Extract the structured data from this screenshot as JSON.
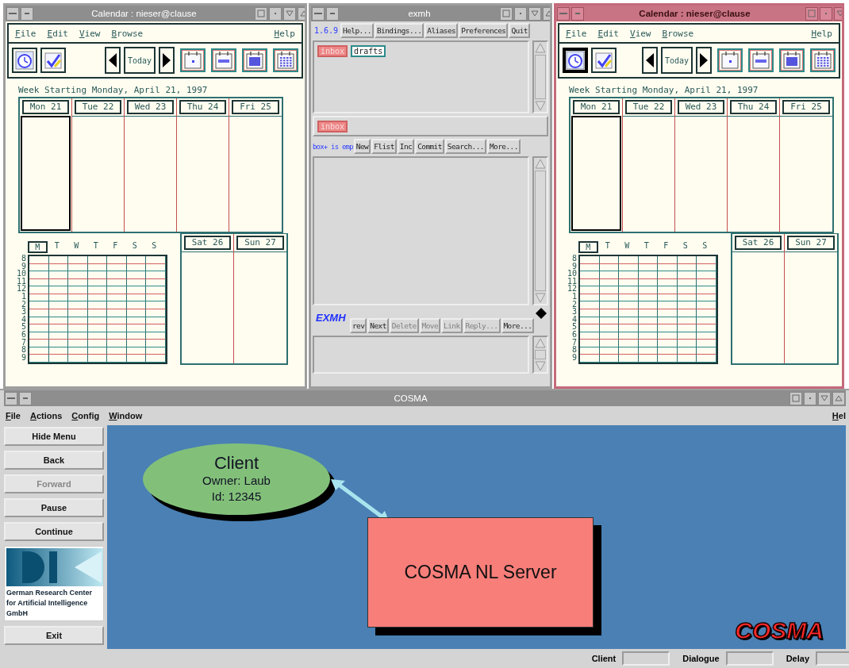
{
  "calendars": [
    {
      "title": "Calendar : nieser@clause",
      "active": false,
      "menu": [
        "File",
        "Edit",
        "View",
        "Browse"
      ],
      "help": "Help",
      "tools": [
        {
          "kind": "clock",
          "selected": false
        },
        {
          "kind": "todo",
          "selected": false
        }
      ],
      "today": "Today",
      "views": [
        {
          "kind": "day"
        },
        {
          "kind": "week"
        },
        {
          "kind": "month"
        },
        {
          "kind": "year"
        }
      ],
      "week_label": "Week Starting Monday, April 21, 1997",
      "weekdays": [
        {
          "label": "Mon 21",
          "selected": true
        },
        {
          "label": "Tue 22",
          "selected": false
        },
        {
          "label": "Wed 23",
          "selected": false
        },
        {
          "label": "Thu 24",
          "selected": false
        },
        {
          "label": "Fri 25",
          "selected": false
        }
      ],
      "weekend": [
        "Sat 26",
        "Sun 27"
      ],
      "mini_days": [
        {
          "label": "M",
          "selected": true
        },
        {
          "label": "T",
          "selected": false
        },
        {
          "label": "W",
          "selected": false
        },
        {
          "label": "T",
          "selected": false
        },
        {
          "label": "F",
          "selected": false
        },
        {
          "label": "S",
          "selected": false
        },
        {
          "label": "S",
          "selected": false
        }
      ],
      "hours": [
        "8",
        "9",
        "10",
        "11",
        "12",
        "1",
        "2",
        "3",
        "4",
        "5",
        "6",
        "7",
        "8",
        "9"
      ]
    },
    {
      "title": "Calendar : nieser@clause",
      "active": true,
      "menu": [
        "File",
        "Edit",
        "View",
        "Browse"
      ],
      "help": "Help",
      "tools": [
        {
          "kind": "clock",
          "selected": true
        },
        {
          "kind": "todo",
          "selected": false
        }
      ],
      "today": "Today",
      "views": [
        {
          "kind": "day"
        },
        {
          "kind": "week"
        },
        {
          "kind": "month"
        },
        {
          "kind": "year"
        }
      ],
      "week_label": "Week Starting Monday, April 21, 1997",
      "weekdays": [
        {
          "label": "Mon 21",
          "selected": true
        },
        {
          "label": "Tue 22",
          "selected": false
        },
        {
          "label": "Wed 23",
          "selected": false
        },
        {
          "label": "Thu 24",
          "selected": false
        },
        {
          "label": "Fri 25",
          "selected": false
        }
      ],
      "weekend": [
        "Sat 26",
        "Sun 27"
      ],
      "mini_days": [
        {
          "label": "M",
          "selected": true
        },
        {
          "label": "T",
          "selected": false
        },
        {
          "label": "W",
          "selected": false
        },
        {
          "label": "T",
          "selected": false
        },
        {
          "label": "F",
          "selected": false
        },
        {
          "label": "S",
          "selected": false
        },
        {
          "label": "S",
          "selected": false
        }
      ],
      "hours": [
        "8",
        "9",
        "10",
        "11",
        "12",
        "1",
        "2",
        "3",
        "4",
        "5",
        "6",
        "7",
        "8",
        "9"
      ]
    }
  ],
  "exmh": {
    "title": "exmh",
    "version": "1.6.9",
    "top_buttons": [
      "Help...",
      "Bindings...",
      "Aliases",
      "Preferences",
      "Quit"
    ],
    "folders": [
      {
        "label": "inbox",
        "selected": true
      },
      {
        "label": "drafts",
        "selected": false
      }
    ],
    "current_folder": "inbox",
    "status": "box+ is emp",
    "folder_buttons": [
      "New",
      "Flist",
      "Inc",
      "Commit",
      "Search...",
      "More..."
    ],
    "logo": "EXMH",
    "message_buttons": [
      {
        "label": "rev",
        "disabled": false
      },
      {
        "label": "Next",
        "disabled": false
      },
      {
        "label": "Delete",
        "disabled": true
      },
      {
        "label": "Move",
        "disabled": true
      },
      {
        "label": "Link",
        "disabled": true
      },
      {
        "label": "Reply...",
        "disabled": true
      },
      {
        "label": "More...",
        "disabled": false
      }
    ]
  },
  "cosma": {
    "title": "COSMA",
    "menu": [
      "File",
      "Actions",
      "Config",
      "Window"
    ],
    "menu_right": "Hel",
    "buttons": [
      {
        "label": "Hide Menu",
        "disabled": false
      },
      {
        "label": "Back",
        "disabled": false
      },
      {
        "label": "Forward",
        "disabled": true
      },
      {
        "label": "Pause",
        "disabled": false
      },
      {
        "label": "Continue",
        "disabled": false
      }
    ],
    "logo_caption": "German Research Center for Artificial Intelligence GmbH",
    "exit": "Exit",
    "client": {
      "title": "Client",
      "lines": [
        "Owner: Laub",
        "Id: 12345"
      ]
    },
    "server": "COSMA NL Server",
    "brand": "COSMA",
    "status": [
      "Client",
      "Dialogue",
      "Delay"
    ]
  }
}
